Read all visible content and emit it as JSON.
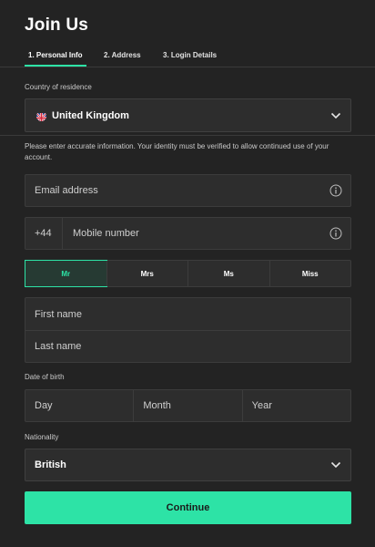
{
  "page": {
    "title": "Join Us"
  },
  "tabs": [
    {
      "label": "1. Personal Info",
      "active": true
    },
    {
      "label": "2. Address",
      "active": false
    },
    {
      "label": "3. Login Details",
      "active": false
    }
  ],
  "country": {
    "label": "Country of residence",
    "value": "United Kingdom",
    "flag_icon": "uk-flag-icon",
    "chevron_icon": "chevron-down-icon"
  },
  "notice": "Please enter accurate information. Your identity must be verified to allow continued use of your account.",
  "email": {
    "placeholder": "Email address",
    "info_icon": "info-icon"
  },
  "mobile": {
    "prefix": "+44",
    "placeholder": "Mobile number",
    "info_icon": "info-icon"
  },
  "titles": {
    "options": [
      "Mr",
      "Mrs",
      "Ms",
      "Miss"
    ],
    "selected": "Mr"
  },
  "names": {
    "first_placeholder": "First name",
    "last_placeholder": "Last name"
  },
  "dob": {
    "label": "Date of birth",
    "day": "Day",
    "month": "Month",
    "year": "Year"
  },
  "nationality": {
    "label": "Nationality",
    "value": "British",
    "chevron_icon": "chevron-down-icon"
  },
  "actions": {
    "continue_label": "Continue"
  },
  "colors": {
    "accent": "#2de3a6",
    "background": "#232323",
    "field": "#2d2d2d"
  }
}
